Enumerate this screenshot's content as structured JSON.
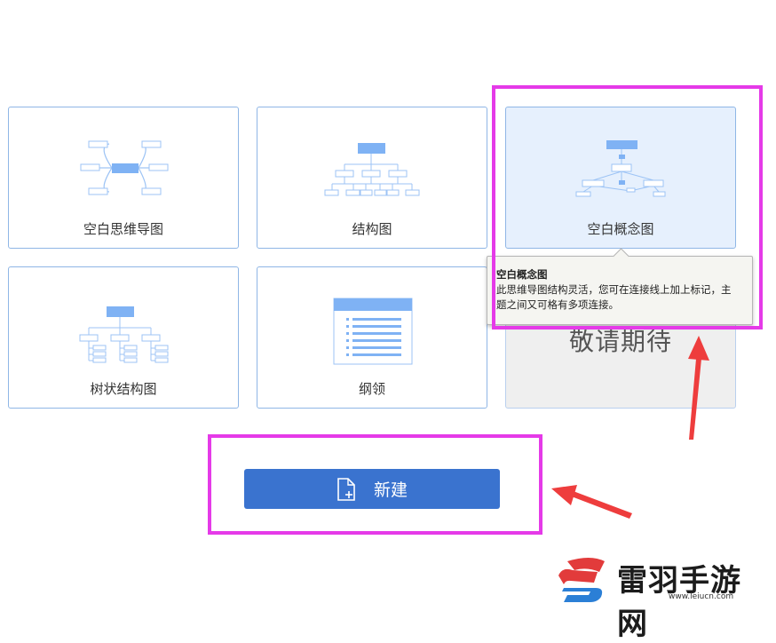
{
  "templates": [
    {
      "id": "blank-mindmap",
      "label": "空白思维导图"
    },
    {
      "id": "structure",
      "label": "结构图"
    },
    {
      "id": "blank-concept",
      "label": "空白概念图"
    },
    {
      "id": "tree",
      "label": "树状结构图"
    },
    {
      "id": "outline",
      "label": "纲领"
    },
    {
      "id": "coming-soon",
      "label": "敬请期待"
    }
  ],
  "tooltip": {
    "title": "空白概念图",
    "line1": "此思维导图结构灵活，您可在连接线上加上标记，主",
    "line2": "题之间又可格有多项连接。"
  },
  "new_button": {
    "label": "新建"
  },
  "watermark": {
    "brand": "雷羽手游网",
    "url": "www.leiucn.com"
  },
  "colors": {
    "highlight": "#e53ae8",
    "arrow": "#ee3d3d",
    "button": "#3a73cf",
    "icon_blue": "#7fb2f4"
  }
}
